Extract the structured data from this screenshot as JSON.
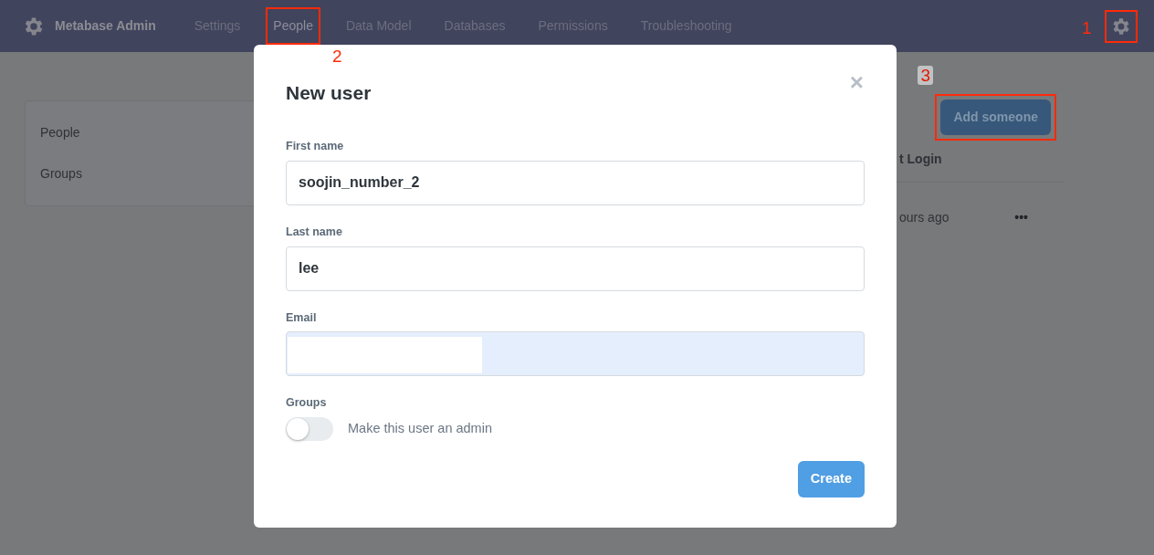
{
  "navbar": {
    "brand": "Metabase Admin",
    "tabs": [
      {
        "label": "Settings",
        "selected": false
      },
      {
        "label": "People",
        "selected": true
      },
      {
        "label": "Data Model",
        "selected": false
      },
      {
        "label": "Databases",
        "selected": false
      },
      {
        "label": "Permissions",
        "selected": false
      },
      {
        "label": "Troubleshooting",
        "selected": false
      }
    ]
  },
  "sidebar": {
    "items": [
      {
        "label": "People"
      },
      {
        "label": "Groups"
      }
    ]
  },
  "main": {
    "add_button": "Add someone",
    "column_heading": "t Login",
    "row_cell": "ours ago",
    "row_menu": "•••"
  },
  "modal": {
    "title": "New user",
    "close": "×",
    "fields": [
      {
        "label": "First name",
        "value": "soojin_number_2",
        "autofilled": false
      },
      {
        "label": "Last name",
        "value": "lee",
        "autofilled": false
      },
      {
        "label": "Email",
        "autofilled": true,
        "redacted": true
      }
    ],
    "groups_label": "Groups",
    "admin_toggle": {
      "label": "Make this user an admin",
      "on": false
    },
    "submit": "Create"
  },
  "annotations": [
    {
      "label": "1"
    },
    {
      "label": "2"
    },
    {
      "label": "3"
    }
  ]
}
